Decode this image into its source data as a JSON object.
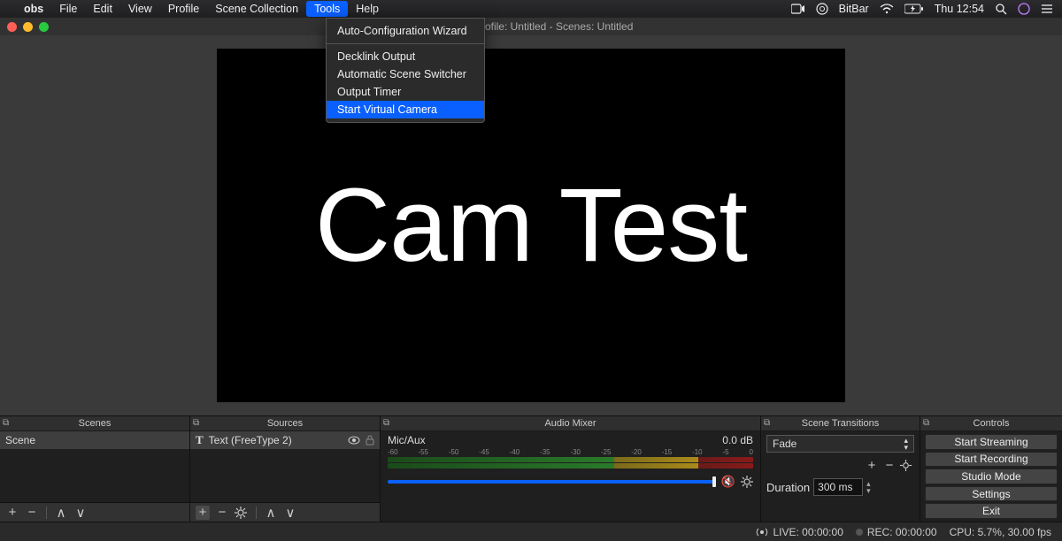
{
  "menubar": {
    "app_name": "obs",
    "items": [
      "File",
      "Edit",
      "View",
      "Profile",
      "Scene Collection",
      "Tools",
      "Help"
    ],
    "active_index": 5,
    "right": {
      "bitbar": "BitBar",
      "clock": "Thu 12:54"
    }
  },
  "dropdown": {
    "items": [
      "Auto-Configuration Wizard",
      "Decklink Output",
      "Automatic Scene Switcher",
      "Output Timer",
      "Start Virtual Camera"
    ],
    "separator_after": [
      0
    ],
    "highlight_index": 4
  },
  "window": {
    "title_suffix": "3 (mac) - Profile: Untitled - Scenes: Untitled"
  },
  "preview": {
    "text": "Cam Test"
  },
  "panels": {
    "scenes": {
      "title": "Scenes",
      "items": [
        "Scene"
      ]
    },
    "sources": {
      "title": "Sources",
      "items": [
        {
          "icon": "T",
          "label": "Text (FreeType 2)"
        }
      ]
    },
    "mixer": {
      "title": "Audio Mixer",
      "track_label": "Mic/Aux",
      "db_label": "0.0 dB",
      "scale": [
        "-60",
        "-55",
        "-50",
        "-45",
        "-40",
        "-35",
        "-30",
        "-25",
        "-20",
        "-15",
        "-10",
        "-5",
        "0"
      ]
    },
    "transitions": {
      "title": "Scene Transitions",
      "selected": "Fade",
      "duration_label": "Duration",
      "duration_value": "300 ms"
    },
    "controls": {
      "title": "Controls",
      "buttons": [
        "Start Streaming",
        "Start Recording",
        "Studio Mode",
        "Settings",
        "Exit"
      ]
    }
  },
  "statusbar": {
    "live": "LIVE: 00:00:00",
    "rec": "REC: 00:00:00",
    "cpu": "CPU: 5.7%, 30.00 fps"
  }
}
